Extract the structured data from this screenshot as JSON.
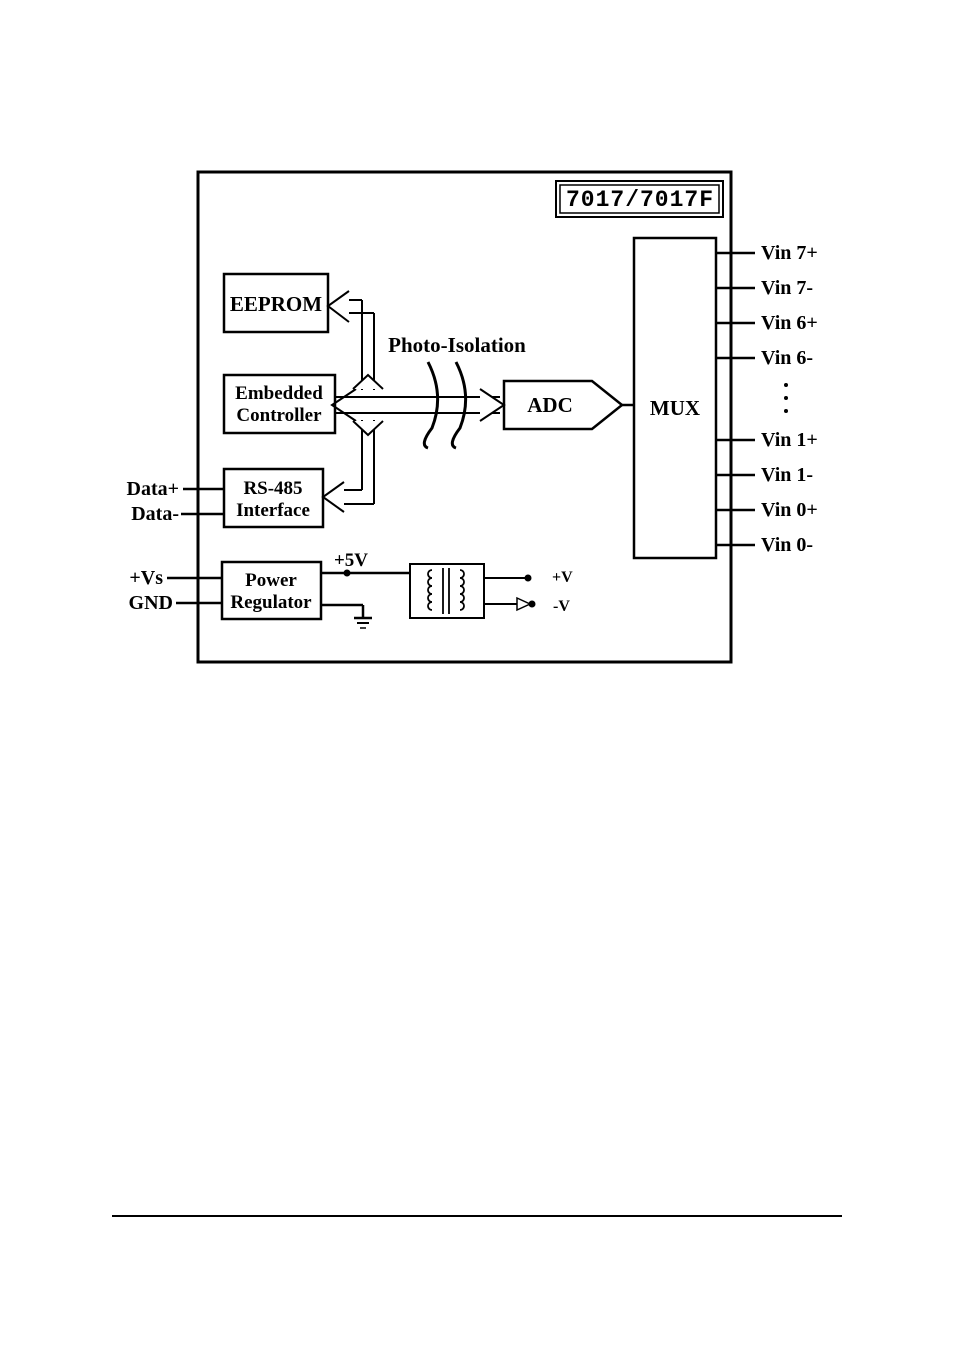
{
  "title": "7017/7017F",
  "blocks": {
    "eeprom": "EEPROM",
    "controller_line1": "Embedded",
    "controller_line2": "Controller",
    "rs485_line1": "RS-485",
    "rs485_line2": "Interface",
    "power_line1": "Power",
    "power_line2": "Regulator",
    "adc": "ADC",
    "mux": "MUX",
    "iso": "Photo-Isolation",
    "five_v": "+5V",
    "plus_v": "+V",
    "minus_v": "-V"
  },
  "left_ports": {
    "data_plus": "Data+",
    "data_minus": "Data-",
    "vs": "+Vs",
    "gnd": "GND"
  },
  "right_ports": [
    "Vin 7+",
    "Vin 7-",
    "Vin 6+",
    "Vin 6-",
    "Vin 1+",
    "Vin 1-",
    "Vin 0+",
    "Vin 0-"
  ]
}
